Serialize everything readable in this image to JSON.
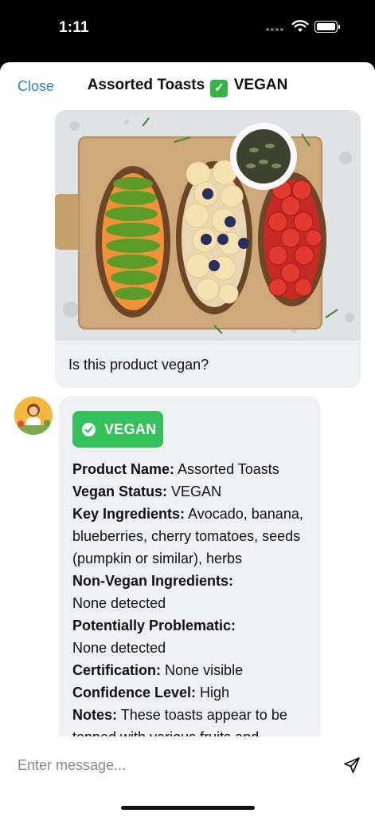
{
  "status_bar": {
    "time": "1:11"
  },
  "header": {
    "close_label": "Close",
    "title_text": "Assorted Toasts",
    "title_badge": "✓",
    "title_suffix": "VEGAN"
  },
  "user_message": {
    "image_description": "Toast with avocado, banana and blueberries, and cherry tomatoes on a wooden board",
    "text": "Is this product vegan?"
  },
  "assistant_message": {
    "badge_label": "VEGAN",
    "fields": [
      {
        "label": "Product Name:",
        "value": "Assorted Toasts"
      },
      {
        "label": "Vegan Status:",
        "value": "VEGAN"
      },
      {
        "label": "Key Ingredients:",
        "value": "Avocado, banana, blueberries, cherry tomatoes, seeds (pumpkin or similar), herbs"
      },
      {
        "label": "Non-Vegan Ingredients:",
        "value": "None detected"
      },
      {
        "label": "Potentially Problematic:",
        "value": "None detected"
      },
      {
        "label": "Certification:",
        "value": "None visible"
      },
      {
        "label": "Confidence Level:",
        "value": "High"
      },
      {
        "label": "Notes:",
        "value": "These toasts appear to be topped with various fruits and"
      }
    ]
  },
  "composer": {
    "placeholder": "Enter message..."
  }
}
